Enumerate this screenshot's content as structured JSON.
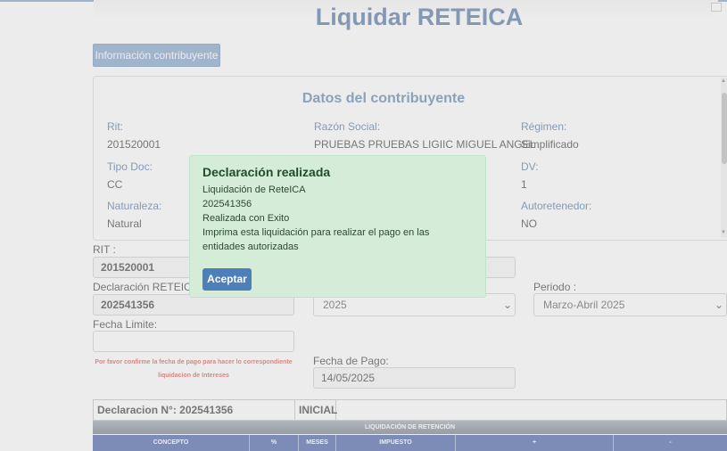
{
  "page": {
    "title": "Liquidar RETEICA"
  },
  "info_button": {
    "label": "Información contribuyente"
  },
  "contribuyente": {
    "title": "Datos del contribuyente",
    "rit_label": "Rit:",
    "rit_value": "201520001",
    "razon_label": "Razón Social:",
    "razon_value": "PRUEBAS PRUEBAS LIGIIC MIGUEL ANGEL",
    "regimen_label": "Régimen:",
    "regimen_value": "Simplificado",
    "tipodoc_label": "Tipo Doc:",
    "tipodoc_value": "CC",
    "dv_label": "DV:",
    "dv_value": "1",
    "naturaleza_label": "Naturaleza:",
    "naturaleza_value": "Natural",
    "autoretenedor_label": "Autoretenedor:",
    "autoretenedor_value": "NO"
  },
  "form": {
    "rit_label": "RIT :",
    "rit_value": "201520001",
    "declaracion_label": "Declaración RETEICA :",
    "declaracion_value": "202541356",
    "anio_value": "2025",
    "periodo_label": "Periodo :",
    "periodo_value": "Marzo-Abril 2025",
    "fecha_limite_label": "Fecha Limite:",
    "fecha_limite_value": "",
    "warning_line1": "Por favor confirme la fecha de pago para hacer lo correspondiente",
    "warning_line2": "liquidacion de Intereses",
    "fecha_pago_label": "Fecha de Pago:",
    "fecha_pago_value": "14/05/2025"
  },
  "table": {
    "declaracion_label": "Declaracion N°: 202541356",
    "estado": "INICIAL",
    "section_title": "LIQUIDACIÓN DE RETENCIÓN",
    "columns": [
      "CONCEPTO",
      "%",
      "MESES",
      "IMPUESTO",
      "+",
      "-"
    ]
  },
  "modal": {
    "title": "Declaración realizada",
    "line1": "Liquidación de ReteICA",
    "line2": "202541356",
    "line3": "Realizada con Exito",
    "line4": "Imprima esta liquidación para realizar el pago en las entidades autorizadas",
    "accept_label": "Aceptar"
  },
  "colors": {
    "accent": "#4a6f9d",
    "modal_bg": "#d4ecd8",
    "modal_title": "#214c26",
    "button": "#4d7fb9",
    "warning": "#d9534f",
    "table_header": "#3e5aa2"
  },
  "icons": {
    "select_arrow": "chevron-down-icon"
  }
}
